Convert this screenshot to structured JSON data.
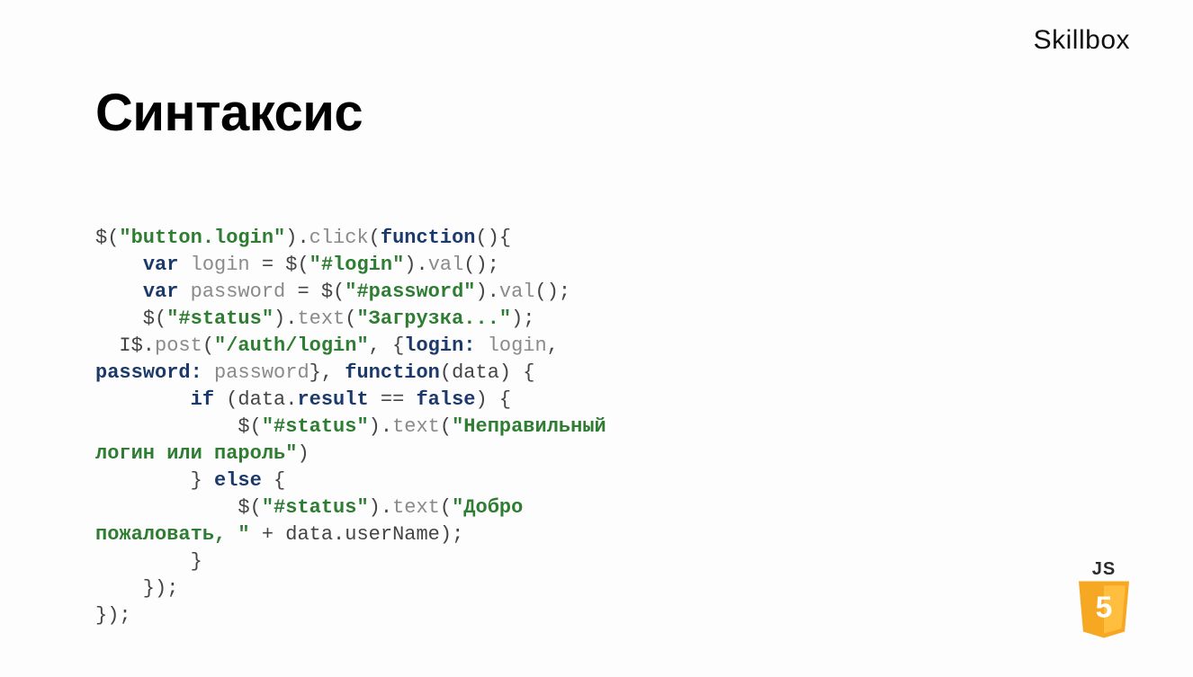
{
  "brand": "Skillbox",
  "title": "Синтаксис",
  "badge": {
    "top_text": "JS",
    "shield_digit": "5"
  },
  "code": {
    "l1": {
      "a": "$(",
      "b": "\"button.login\"",
      "c": ").",
      "d": "click",
      "e": "(",
      "f": "function",
      "g": "(){"
    },
    "l2": {
      "a": "    ",
      "b": "var",
      "c": " ",
      "d": "login",
      "e": " = $(",
      "f": "\"#login\"",
      "g": ").",
      "h": "val",
      "i": "();"
    },
    "l3": {
      "a": "    ",
      "b": "var",
      "c": " ",
      "d": "password",
      "e": " = $(",
      "f": "\"#password\"",
      "g": ").",
      "h": "val",
      "i": "();"
    },
    "l4": {
      "a": "    $(",
      "b": "\"#status\"",
      "c": ").",
      "d": "text",
      "e": "(",
      "f": "\"Загрузка...\"",
      "g": ");"
    },
    "l5": {
      "a": "  I$.",
      "b": "post",
      "c": "(",
      "d": "\"/auth/login\"",
      "e": ", {",
      "f": "login:",
      "g": " ",
      "h": "login",
      "i": ","
    },
    "l6": {
      "a": "password:",
      "b": " ",
      "c": "password",
      "d": "}, ",
      "e": "function",
      "f": "(data) {"
    },
    "l7": {
      "a": "        ",
      "b": "if",
      "c": " (data.",
      "d": "result",
      "e": " == ",
      "f": "false",
      "g": ") {"
    },
    "l8": {
      "a": "            $(",
      "b": "\"#status\"",
      "c": ").",
      "d": "text",
      "e": "(",
      "f": "\"Неправильный"
    },
    "l9": {
      "a": "логин или пароль\"",
      "b": ")"
    },
    "l10": {
      "a": "        } ",
      "b": "else",
      "c": " {"
    },
    "l11": {
      "a": "            $(",
      "b": "\"#status\"",
      "c": ").",
      "d": "text",
      "e": "(",
      "f": "\"Добро"
    },
    "l12": {
      "a": "пожаловать, \"",
      "b": " + data.userName);"
    },
    "l13": {
      "a": "        }"
    },
    "l14": {
      "a": "    });"
    },
    "l15": {
      "a": "});"
    }
  }
}
